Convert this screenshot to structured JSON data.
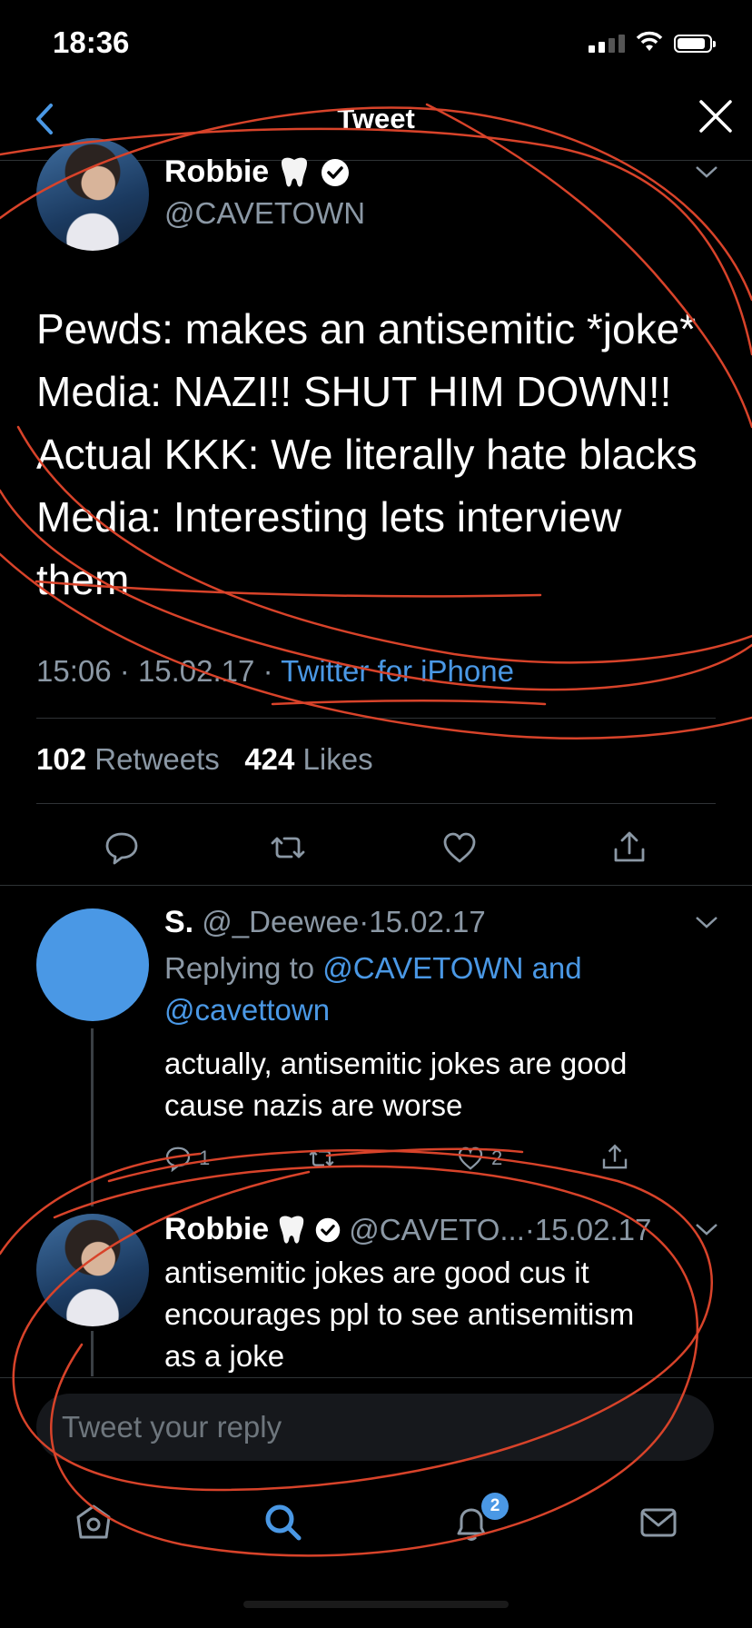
{
  "status_bar": {
    "time": "18:36"
  },
  "nav": {
    "title": "Tweet"
  },
  "main_tweet": {
    "name": "Robbie",
    "handle": "@CAVETOWN",
    "lines": [
      "Pewds: makes an antisemitic *joke*",
      "Media: NAZI!! SHUT HIM DOWN!!",
      "Actual KKK: We literally hate blacks",
      "Media: Interesting lets interview",
      "them"
    ],
    "time": "15:06",
    "date": "15.02.17",
    "source": "Twitter for iPhone",
    "separator": "·",
    "retweet_count": "102",
    "retweet_label": "Retweets",
    "like_count": "424",
    "like_label": "Likes"
  },
  "reply1": {
    "name": "S.",
    "handle": "@_Deewee",
    "date": "·15.02.17",
    "replying_prefix": "Replying to",
    "replying_to": "@CAVETOWN and",
    "replying_to_2": "@cavettown",
    "text_lines": [
      "actually, antisemitic jokes are good",
      "cause nazis are worse"
    ],
    "reply_count": "1",
    "like_count": "2"
  },
  "reply2": {
    "name": "Robbie",
    "handle": "@CAVETO...",
    "date": "·15.02.17",
    "text_lines": [
      "antisemitic jokes are good cus it",
      "encourages ppl to see antisemitism",
      "as a joke"
    ]
  },
  "compose": {
    "placeholder": "Tweet your reply"
  },
  "tab_bar": {
    "notification_badge": "2"
  },
  "colors": {
    "accent": "#4a98e5",
    "background": "#000000",
    "muted": "#8b98a5",
    "annotation": "#d8432a"
  },
  "icons": [
    "back-chevron-icon",
    "close-icon",
    "tooth-emoji-icon",
    "verified-badge-icon",
    "chevron-down-icon",
    "reply-icon",
    "retweet-icon",
    "like-icon",
    "share-icon",
    "home-icon",
    "search-icon",
    "notifications-icon",
    "messages-icon"
  ]
}
